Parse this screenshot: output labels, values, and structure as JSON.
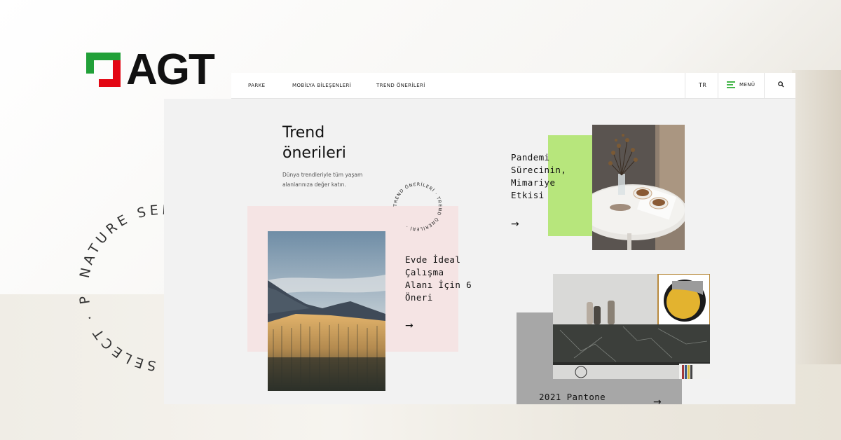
{
  "brand": {
    "name": "AGT",
    "colors": {
      "green": "#21a038",
      "red": "#e30613"
    }
  },
  "nav": {
    "items": [
      "PARKE",
      "MOBİLYA BİLEŞENLERİ",
      "TREND ÖNERİLERİ"
    ],
    "lang": "TR",
    "menu_label": "MENÜ",
    "menu_icon": "hamburger-icon",
    "search_icon": "search-icon"
  },
  "hero": {
    "title_line1": "Trend",
    "title_line2": "önerileri",
    "subtitle_line1": "Dünya trendleriyle tüm yaşam",
    "subtitle_line2": "alanlarınıza değer katın.",
    "badge_text": "TREND ÖNERİLERİ · TREND ÖNERİLERİ ·"
  },
  "cards": [
    {
      "lines": [
        "Evde İdeal",
        "Çalışma",
        "Alanı İçin 6",
        "Öneri"
      ],
      "arrow": "→",
      "accent": "#f5e4e4"
    },
    {
      "lines": [
        "Pandemi",
        "Sürecinin,",
        "Mimariye",
        "Etkisi"
      ],
      "arrow": "→",
      "accent": "#b7e67c"
    },
    {
      "lines": [
        "2021 Pantone"
      ],
      "arrow": "→",
      "accent": "#a7a7a7"
    }
  ],
  "ring_text": "NATURE SELECT · PARKE · NATURE SELECT · PARKE ·"
}
